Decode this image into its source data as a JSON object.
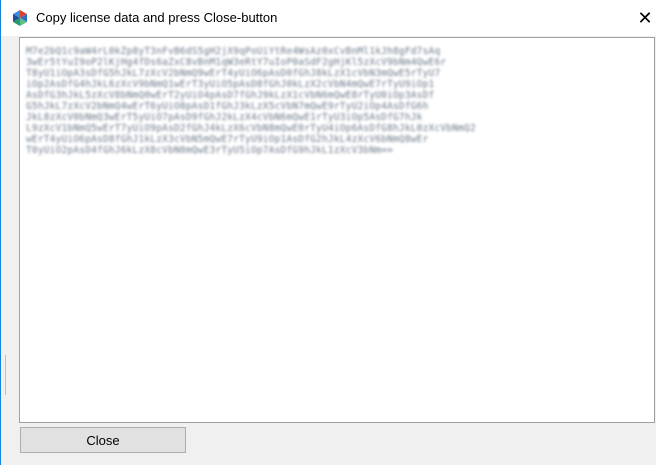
{
  "window": {
    "title": "Copy license data and press Close-button",
    "close_glyph": "✕",
    "app_icon": "app-logo-icon",
    "accent_color": "#1883d7"
  },
  "license": {
    "text_lines": [
      "M7e2bQ1c9aW4rL0kZp8yT3nFvB6dS5gH2jX9qPoUiYtRe4WsAz0xCvBnMl1kJh8gFd7sAq",
      "3wEr5tYuI9oP2lKjHg4fDs6aZxC8vBnM1qW3eRtY7uIoP0aSdF2gHjKl5zXcV9bNm4QwE6r",
      "T8yU1iOpA3sDfG5hJkL7zXcV2bNmQ9wErT4yUiO6pAsD0fGhJ8kLzX1cVbN3mQwE5rTyU7",
      "iOp2AsDfG4hJkL6zXcV9bNmQ1wErT3yUiO5pAsD8fGhJ0kLzX2cVbN4mQwE7rTyU9iOp1",
      "AsDfG3hJkL5zXcV8bNmQ0wErT2yUiO4pAsD7fGhJ9kLzX1cVbN6mQwE8rTyU0iOp3AsDf",
      "G5hJkL7zXcV2bNmQ4wErT6yUiO8pAsD1fGhJ3kLzX5cVbN7mQwE9rTyU2iOp4AsDfG6h",
      "JkL8zXcV0bNmQ3wErT5yUiO7pAsD9fGhJ2kLzX4cVbN6mQwE1rTyU3iOp5AsDfG7hJk",
      "L9zXcV1bNmQ5wErT7yUiO9pAsD2fGhJ4kLzX6cVbN8mQwE0rTyU4iOp6AsDfG8hJkL0zXcVbNmQ2",
      "wErT4yUiO6pAsD8fGhJ1kLzX3cVbN5mQwE7rTyU9iOp1AsDfG2hJkL4zXcV6bNmQ8wEr",
      "T0yUiO2pAsD4fGhJ6kLzX8cVbN0mQwE3rTyU5iOp7AsDfG9hJkL1zXcV3bNm=="
    ]
  },
  "buttons": {
    "close_label": "Close"
  }
}
